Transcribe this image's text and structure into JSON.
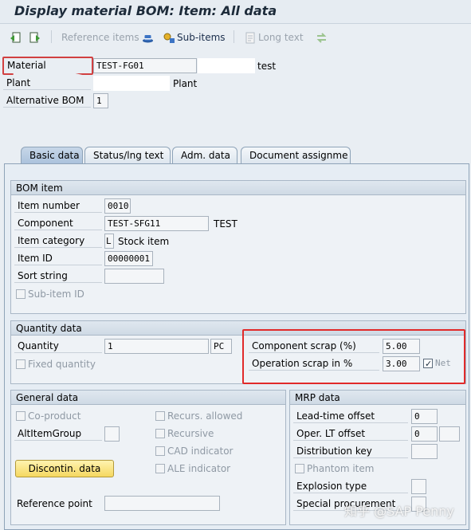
{
  "window": {
    "title": "Display material BOM: Item: All data"
  },
  "toolbar": {
    "reference_items": "Reference items",
    "sub_items": "Sub-items",
    "long_text": "Long text"
  },
  "header": {
    "material_label": "Material",
    "material_value": "TEST-FG01",
    "material_desc": "test",
    "plant_label": "Plant",
    "plant_desc": "Plant",
    "alt_bom_label": "Alternative BOM",
    "alt_bom_value": "1"
  },
  "tabs": [
    {
      "label": "Basic data"
    },
    {
      "label": "Status/lng text"
    },
    {
      "label": "Adm. data"
    },
    {
      "label": "Document assignme"
    }
  ],
  "bom_item": {
    "title": "BOM item",
    "item_number_label": "Item number",
    "item_number_value": "0010",
    "component_label": "Component",
    "component_value": "TEST-SFG11",
    "component_desc": "TEST",
    "item_category_label": "Item category",
    "item_category_value": "L",
    "item_category_desc": "Stock item",
    "item_id_label": "Item ID",
    "item_id_value": "00000001",
    "sort_string_label": "Sort string",
    "sub_item_id_label": "Sub-item ID"
  },
  "quantity_data": {
    "title": "Quantity data",
    "quantity_label": "Quantity",
    "quantity_value": "1",
    "unit_value": "PC",
    "fixed_quantity_label": "Fixed quantity",
    "component_scrap_label": "Component scrap (%)",
    "component_scrap_value": "5.00",
    "operation_scrap_label": "Operation scrap in %",
    "operation_scrap_value": "3.00",
    "net_label": "Net",
    "net_checked": true
  },
  "general_data": {
    "title": "General data",
    "co_product_label": "Co-product",
    "alt_item_group_label": "AltItemGroup",
    "recurs_allowed_label": "Recurs. allowed",
    "recursive_label": "Recursive",
    "cad_indicator_label": "CAD indicator",
    "ale_indicator_label": "ALE indicator",
    "discontin_button": "Discontin. data",
    "reference_point_label": "Reference point"
  },
  "mrp_data": {
    "title": "MRP data",
    "lead_time_offset_label": "Lead-time offset",
    "lead_time_offset_value": "0",
    "oper_lt_offset_label": "Oper. LT offset",
    "oper_lt_offset_value": "0",
    "distribution_key_label": "Distribution key",
    "phantom_item_label": "Phantom item",
    "explosion_type_label": "Explosion type",
    "special_procurement_label": "Special procurement"
  },
  "watermark": "知乎 @SAP Penny"
}
